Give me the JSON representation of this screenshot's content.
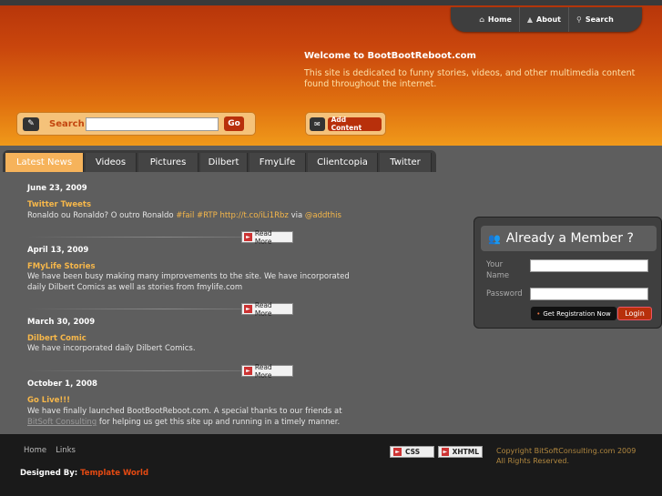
{
  "topnav": {
    "items": [
      {
        "label": "Home",
        "icon": "home-icon"
      },
      {
        "label": "About",
        "icon": "about-icon"
      },
      {
        "label": "Search",
        "icon": "search-icon"
      }
    ]
  },
  "welcome": {
    "title": "Welcome to BootBootReboot.com",
    "text": "This site is dedicated to funny stories, videos, and other multimedia content found throughout the internet."
  },
  "search": {
    "label": "Search",
    "value": "",
    "go_label": "Go"
  },
  "add_content": {
    "label": "Add Content"
  },
  "tabs": [
    {
      "label": "Latest News",
      "active": true
    },
    {
      "label": "Videos"
    },
    {
      "label": "Pictures"
    },
    {
      "label": "Dilbert"
    },
    {
      "label": "FmyLife"
    },
    {
      "label": "Clientcopia"
    },
    {
      "label": "Twitter"
    }
  ],
  "news": [
    {
      "date": "June 23, 2009",
      "title": "Twitter Tweets",
      "text_plain": "Ronaldo ou Ronaldo? O outro Ronaldo ",
      "text_hl1": "#fail",
      "text_hl2": "#RTP",
      "text_link": "http://t.co/iLi1Rbz",
      "text_via": " via ",
      "text_user": "@addthis",
      "read_more": "Read More"
    },
    {
      "date": "April 13, 2009",
      "title": "FMyLife Stories",
      "text": "We have been busy making many improvements to the site. We have incorporated daily Dilbert Comics as well as stories from fmylife.com",
      "read_more": "Read More"
    },
    {
      "date": "March 30, 2009",
      "title": "Dilbert Comic",
      "text": "We have incorporated daily Dilbert Comics.",
      "read_more": "Read More"
    },
    {
      "date": "October 1, 2008",
      "title": "Go Live!!!",
      "text_a": "We have finally launched BootBootReboot.com. A special thanks to our friends at ",
      "text_link": "BitSoft Consulting",
      "text_b": " for helping us get this site up and running in a timely manner."
    }
  ],
  "member": {
    "title": "Already a Member ?",
    "name_label": "Your Name",
    "password_label": "Password",
    "register_label": "Get Registration Now",
    "login_label": "Login"
  },
  "footer": {
    "links": [
      "Home",
      "Links"
    ],
    "designed_by": "Designed By:",
    "designer": "Template World",
    "css_badge": "CSS",
    "xhtml_badge": "XHTML",
    "copyright_1": "Copyright BitSoftConsulting.com 2009",
    "copyright_2": "All Rights Reserved."
  },
  "colors": {
    "accent": "#f6b74a",
    "header_top": "#b8360a",
    "header_bottom": "#f0991a",
    "button_red": "#b8300b"
  }
}
